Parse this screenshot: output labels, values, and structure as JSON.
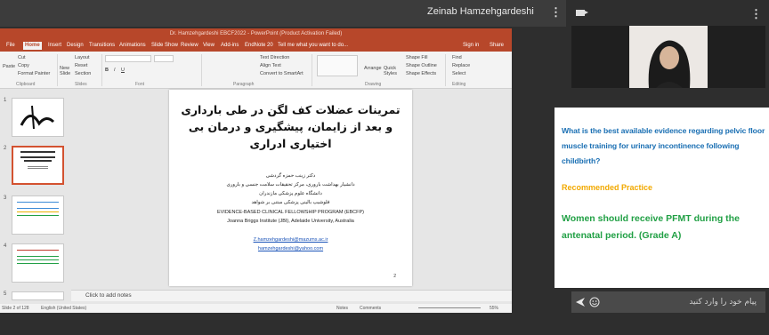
{
  "meeting": {
    "presenter_name": "Zeinab Hamzehgardeshi",
    "chat_placeholder": "پیام خود را وارد کنید"
  },
  "ppt": {
    "window_title": "Dr. Hamzehgardeshi EBCF2022 - PowerPoint (Product Activation Failed)",
    "tabs": [
      "File",
      "Home",
      "Insert",
      "Design",
      "Transitions",
      "Animations",
      "Slide Show",
      "Review",
      "View",
      "Add-ins",
      "EndNote 20"
    ],
    "tell_me": "Tell me what you want to do...",
    "sign_in": "Sign in",
    "share": "Share",
    "ribbon": {
      "paste": "Paste",
      "cut": "Cut",
      "copy": "Copy",
      "format_painter": "Format Painter",
      "new_slide": "New Slide",
      "layout": "Layout",
      "reset": "Reset",
      "section": "Section",
      "text_direction": "Text Direction",
      "align_text": "Align Text",
      "convert_smartart": "Convert to SmartArt",
      "arrange": "Arrange",
      "quick_styles": "Quick Styles",
      "shape_fill": "Shape Fill",
      "shape_outline": "Shape Outline",
      "shape_effects": "Shape Effects",
      "find": "Find",
      "replace": "Replace",
      "select": "Select",
      "groups": [
        "Clipboard",
        "Slides",
        "Font",
        "Paragraph",
        "Drawing",
        "Editing"
      ]
    },
    "thumb_numbers": [
      "1",
      "2",
      "3",
      "4",
      "5"
    ],
    "slide": {
      "title": "تمرینات عضلات کف لگن در طی بارداری و بعد از زایمان، پیشگیری و درمان بی اختیاری ادراری",
      "author": "دکتر زینب حمزه گردشی",
      "line2": "دانشیار بهداشت باروری، مرکز تحقیقات سلامت جنسی و باروری",
      "line3": "دانشگاه علوم پزشکی مازندران",
      "line4": "فلوشیپ بالینی پزشکی مبتنی بر شواهد",
      "program": "EVIDENCE-BASED CLINICAL FELLOWSHIP PROGRAM (EBCFP)",
      "institute": "Joanna Briggs Institute (JBI), Adelaide University, Australia",
      "email1": "Z.hamzehgardeshi@mazums.ac.ir",
      "email2": "hamzehgardeshi@yahoo.com",
      "page": "2"
    },
    "notes_placeholder": "Click to add notes",
    "status": {
      "slide_of": "Slide 2 of 128",
      "language": "English (United States)",
      "notes": "Notes",
      "comments": "Comments",
      "zoom": "55%"
    }
  },
  "poll": {
    "question": "What is the best available evidence regarding pelvic floor muscle training for urinary incontinence following childbirth?",
    "heading": "Recommended Practice",
    "answer": "Women should receive PFMT during the antenatal period. (Grade A)",
    "colors": {
      "question": "#1a6fb3",
      "heading": "#f2a900",
      "answer": "#21a045"
    }
  }
}
